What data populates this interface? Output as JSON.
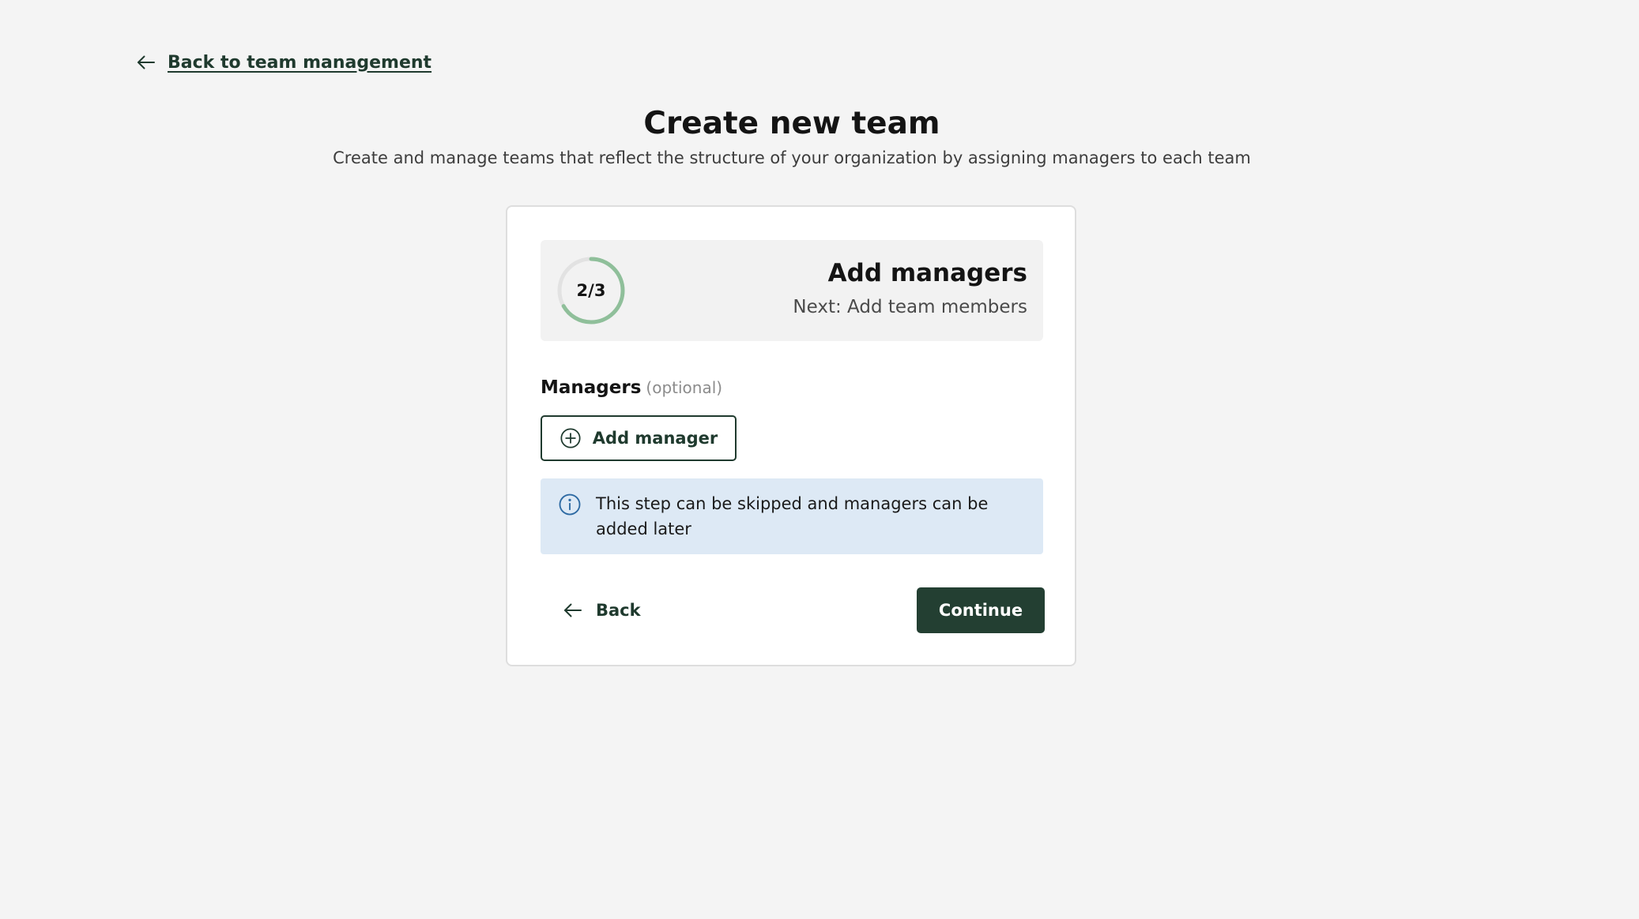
{
  "nav": {
    "back_link_label": "Back to team management"
  },
  "header": {
    "title": "Create new team",
    "subtitle": "Create and manage teams that reflect the structure of your organization by assigning managers to each team"
  },
  "step": {
    "label": "2/3",
    "current": 2,
    "total": 3,
    "progress_fraction": 0.667,
    "title": "Add managers",
    "next": "Next: Add team members"
  },
  "managers": {
    "label": "Managers",
    "optional_label": "(optional)",
    "add_button_label": "Add manager"
  },
  "info": {
    "text": "This step can be skipped and managers can be added later"
  },
  "actions": {
    "back_label": "Back",
    "continue_label": "Continue"
  },
  "colors": {
    "progress_ring": "#8fbf9a",
    "progress_track": "#e2e2e2",
    "primary": "#233f32",
    "info_background": "#dde9f5",
    "info_icon": "#2d6aa3"
  },
  "icons": {
    "back_link": "arrow-left-icon",
    "add_manager": "plus-circle-icon",
    "info": "info-icon",
    "back_button": "arrow-left-icon"
  }
}
